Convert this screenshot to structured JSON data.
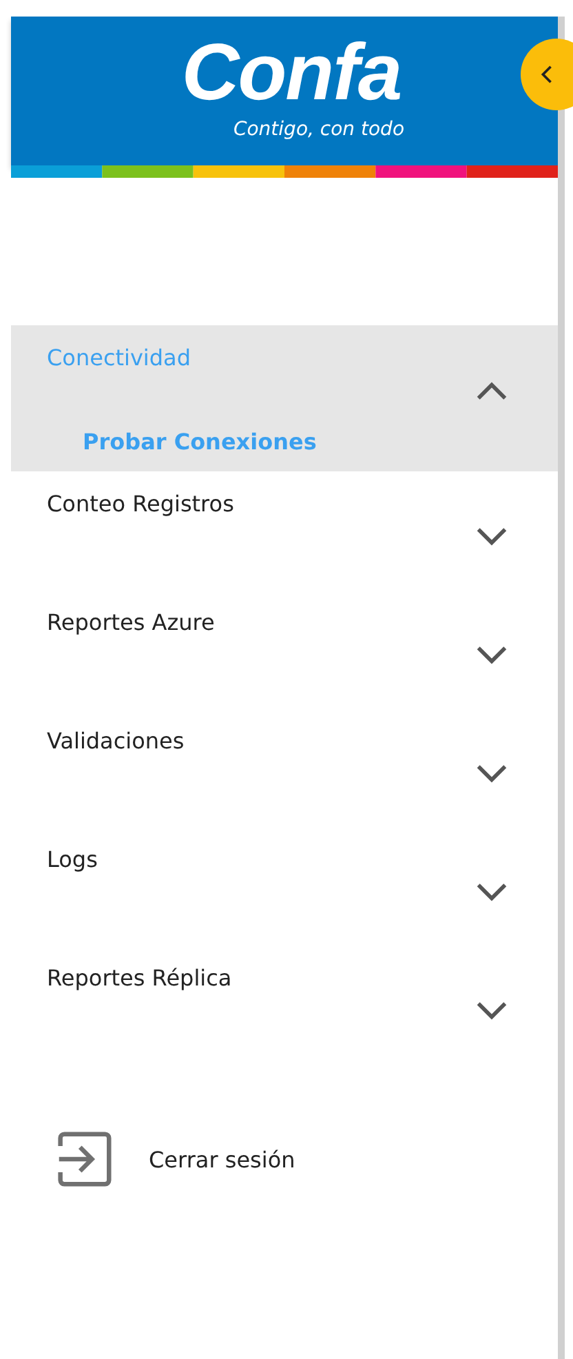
{
  "header": {
    "logo": "Confa",
    "tagline": "Contigo, con todo"
  },
  "menu": [
    {
      "label": "Conectividad",
      "expanded": true,
      "children": [
        {
          "label": "Probar Conexiones"
        }
      ]
    },
    {
      "label": "Conteo Registros",
      "expanded": false
    },
    {
      "label": "Reportes Azure",
      "expanded": false
    },
    {
      "label": "Validaciones",
      "expanded": false
    },
    {
      "label": "Logs",
      "expanded": false
    },
    {
      "label": "Reportes Réplica",
      "expanded": false
    }
  ],
  "logout": {
    "label": "Cerrar sesión"
  }
}
